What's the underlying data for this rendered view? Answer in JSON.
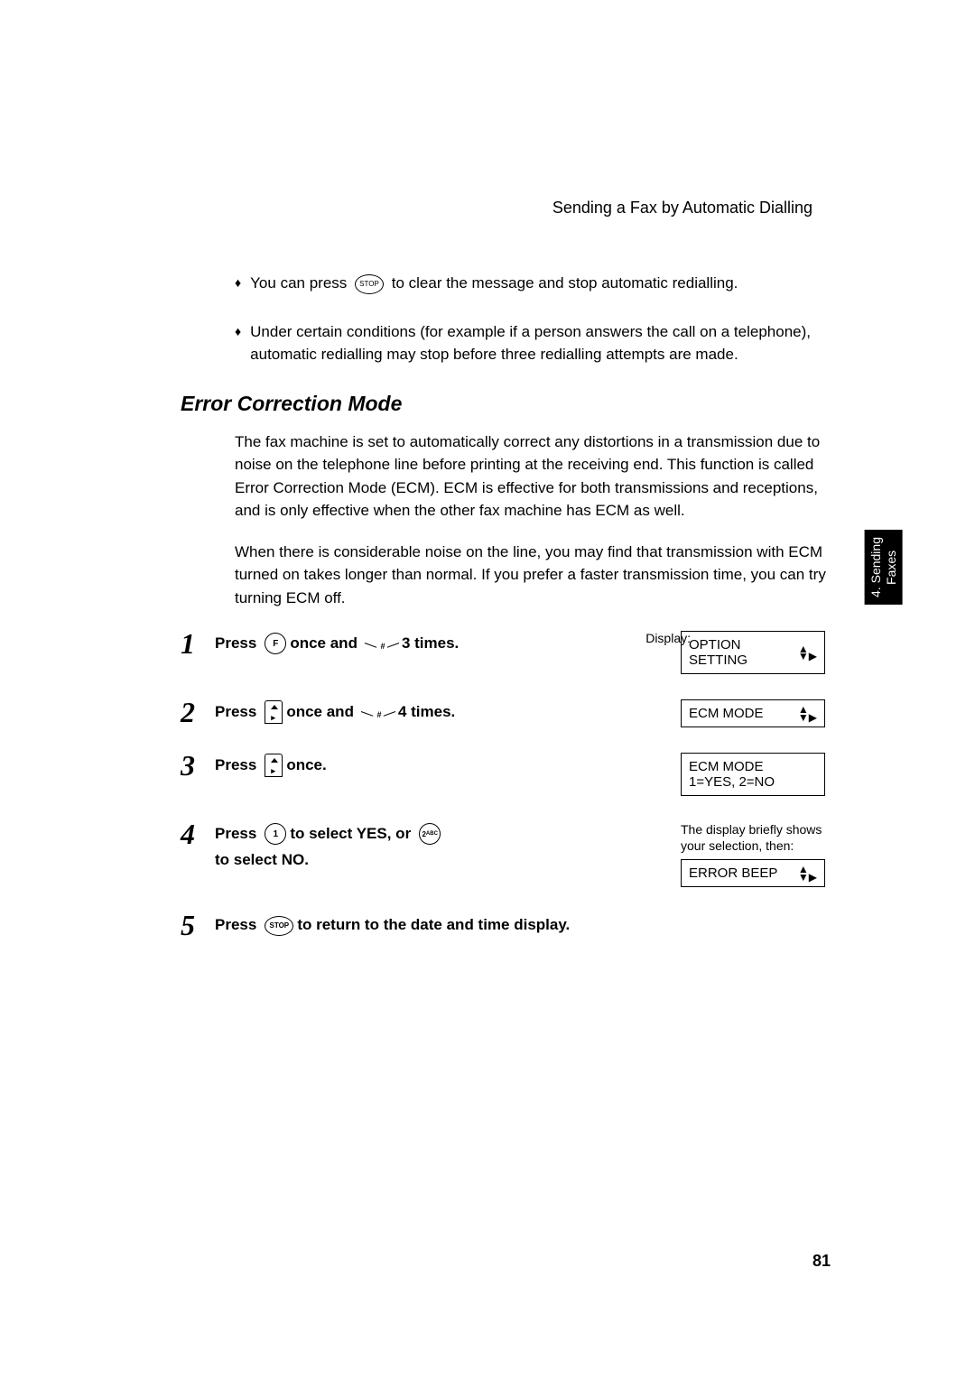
{
  "header": "Sending a Fax by Automatic Dialling",
  "bullets": [
    {
      "pre": "You can press ",
      "post": " to clear the message and stop automatic redialling.",
      "icon": "STOP"
    },
    {
      "text": "Under certain conditions (for example if a person answers the call on a telephone), automatic redialling may stop before three redialling attempts are made."
    }
  ],
  "section_title": "Error Correction Mode",
  "para1": "The fax machine is set to automatically correct any distortions in a transmission due to noise on the telephone line before printing at the receiving end. This function is called Error Correction Mode (ECM). ECM is effective for both transmissions and receptions, and is only effective when the other fax machine has ECM as well.",
  "para2": "When there is considerable noise on the line, you may find that transmission with ECM turned on takes longer than normal. If you prefer a faster transmission time, you can try turning ECM off.",
  "display_label": "Display:",
  "steps": [
    {
      "num": "1",
      "parts": [
        "Press ",
        {
          "icon": "F"
        },
        " once and ",
        {
          "seg": "#"
        },
        " 3 times."
      ],
      "display": {
        "text": "OPTION SETTING",
        "nav": true
      }
    },
    {
      "num": "2",
      "parts": [
        "Press ",
        {
          "arrow": true
        },
        " once and ",
        {
          "seg": "#"
        },
        " 4 times."
      ],
      "display": {
        "text": "ECM MODE",
        "nav": true
      }
    },
    {
      "num": "3",
      "parts": [
        "Press ",
        {
          "arrow": true
        },
        " once."
      ],
      "display": {
        "text": "ECM MODE",
        "sub": "1=YES, 2=NO"
      }
    },
    {
      "num": "4",
      "parts": [
        "Press ",
        {
          "icon": "1"
        },
        " to select YES, or ",
        {
          "icon": "2ABC"
        },
        " to select NO."
      ],
      "note": "The display briefly shows your selection, then:",
      "display": {
        "text": "ERROR BEEP",
        "nav": true
      }
    },
    {
      "num": "5",
      "parts": [
        "Press ",
        {
          "oval": "STOP"
        },
        " to return to the date and time display."
      ]
    }
  ],
  "side_tab": "4. Sending\nFaxes",
  "page": "81"
}
